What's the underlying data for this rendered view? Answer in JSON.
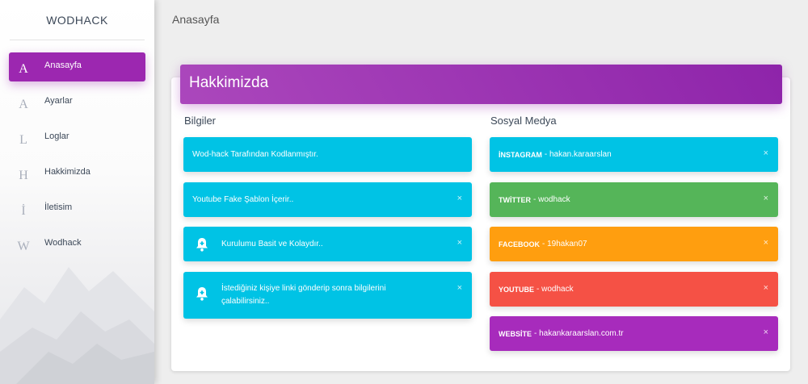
{
  "brand": "WODHACK",
  "page_title": "Anasayfa",
  "menu": [
    {
      "letter": "A",
      "label": "Anasayfa",
      "active": true
    },
    {
      "letter": "A",
      "label": "Ayarlar"
    },
    {
      "letter": "L",
      "label": "Loglar"
    },
    {
      "letter": "H",
      "label": "Hakkimizda"
    },
    {
      "letter": "İ",
      "label": "İletisim"
    },
    {
      "letter": "W",
      "label": "Wodhack"
    }
  ],
  "card": {
    "title": "Hakkimizda",
    "left_title": "Bilgiler",
    "right_title": "Sosyal Medya",
    "bilgiler": [
      "Wod-hack Tarafından Kodlanmıştır.",
      "Youtube Fake Şablon İçerir..",
      "Kurulumu Basit ve Kolaydır..",
      "İstediğiniz kişiye linki gönderip sonra bilgilerini çalabilirsiniz.."
    ],
    "sosyal": [
      {
        "platform": "İNSTAGRAM",
        "value": " - hakan.karaarslan"
      },
      {
        "platform": "TWİTTER",
        "value": " - wodhack"
      },
      {
        "platform": "FACEBOOK",
        "value": " - 19hakan07"
      },
      {
        "platform": "YOUTUBE",
        "value": " - wodhack"
      },
      {
        "platform": "WEBSİTE",
        "value": " - hakankaraarslan.com.tr"
      }
    ],
    "close_glyph": "×"
  },
  "colors": {
    "info": "#00c3e5",
    "success": "#55b559",
    "warning": "#ff9e0f",
    "danger": "#f55145",
    "primary": "#a72bbc",
    "active": "#9c27b0"
  },
  "icons": {
    "bell": "bell-plus-icon",
    "close": "close-icon"
  }
}
